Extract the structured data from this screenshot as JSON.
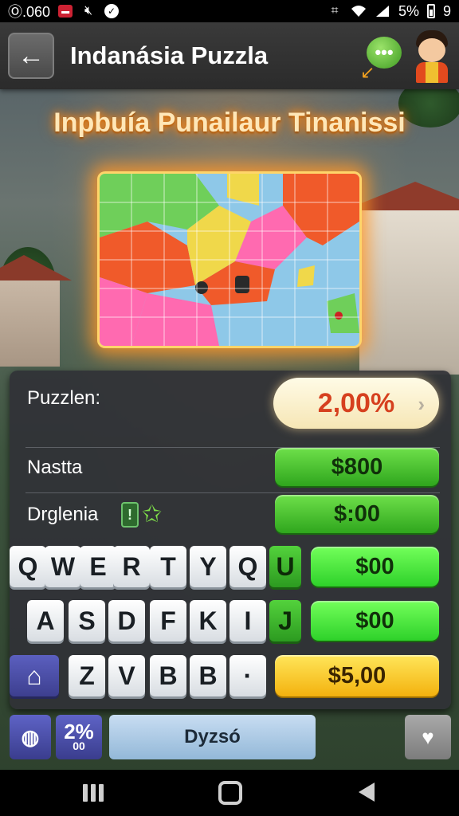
{
  "status_bar": {
    "time": "060",
    "left_prefix": "Ⓞ",
    "battery_text": "5%",
    "battery_level": "9",
    "icons": [
      "notification-icon",
      "mute-icon",
      "message-icon",
      "vibrate-icon",
      "wifi-icon",
      "signal-icon",
      "battery-icon"
    ]
  },
  "header": {
    "title": "Indanásia Puzzla",
    "back_glyph": "←",
    "chat_glyph": "•••",
    "chat_arrow_glyph": "↙"
  },
  "puzzle": {
    "title": "Inpbuía Punailaur Tinanissi"
  },
  "panel": {
    "progress_label": "Puzzlen:",
    "progress_value": "2,00%",
    "progress_chevron": "›",
    "row1_label": "Nastta",
    "row1_value": "$800",
    "row2_label": "Drglenia",
    "row2_badge": "!",
    "row2_star": "✩",
    "row2_value": "$:00",
    "row3_value": "$00",
    "row4_value": "$00",
    "row5_value": "$5,00"
  },
  "keyboard": {
    "row1": [
      "Q",
      "W",
      "E",
      "R",
      "T",
      "Y",
      "Q",
      "U"
    ],
    "row2": [
      "A",
      "S",
      "D",
      "F",
      "K",
      "I",
      "J"
    ],
    "row3": [
      "⌂",
      "Z",
      "V",
      "B",
      "B",
      "·"
    ]
  },
  "toolbar": {
    "globe_glyph": "◍",
    "percent_label": "2%",
    "percent_sub": "00",
    "space_label": "Dyzsó",
    "heart_glyph": "♥"
  },
  "colors": {
    "accent_green": "#2fa61d",
    "accent_yellow": "#f3b10e",
    "percent_red": "#d6401f",
    "title_glow": "#ff8c1a"
  }
}
